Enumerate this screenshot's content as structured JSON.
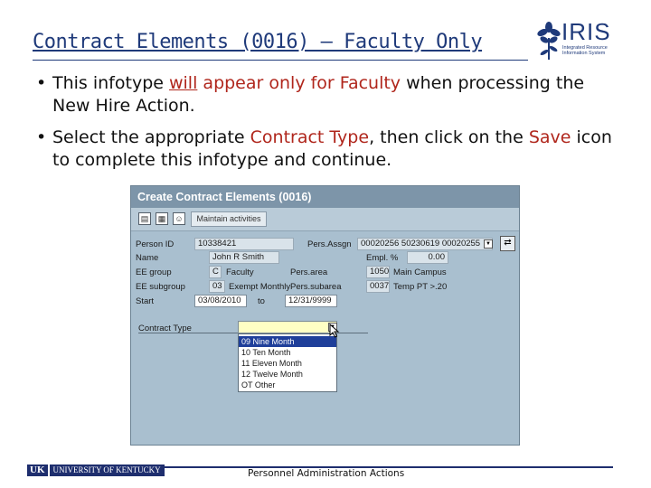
{
  "slide": {
    "title": "Contract Elements (0016) – Faculty Only",
    "bullets": [
      {
        "bullet_char": "•",
        "t1": "This infotype ",
        "t2": "will",
        "t3": " ",
        "t4": "appear only for Faculty",
        "t5": " when processing the New Hire Action."
      },
      {
        "bullet_char": "•",
        "t1": "Select the appropriate ",
        "t2": "Contract Type",
        "t3": ", then click on the ",
        "t4": "Save",
        "t5": " icon to complete this infotype and continue."
      }
    ],
    "footer": "Personnel Administration Actions",
    "highlight_color": "#b0261c",
    "title_color": "#1f3a7a"
  },
  "logo": {
    "word": "IRIS",
    "sub_lines": [
      "Integrated Resource",
      "Information System"
    ],
    "icon": "flower-icon"
  },
  "footer_logo": {
    "uk": "UK",
    "name": "UNIVERSITY OF KENTUCKY"
  },
  "sap": {
    "title": "Create Contract Elements (0016)",
    "toolbar": {
      "button_label": "Maintain activities",
      "icons": [
        "document-icon",
        "copy-icon",
        "person-icon"
      ]
    },
    "labels": {
      "person_id": "Person ID",
      "pers_assgn": "Pers.Assgn",
      "name": "Name",
      "empl_pct": "Empl. %",
      "ee_group": "EE group",
      "pers_area": "Pers.area",
      "ee_subgroup": "EE subgroup",
      "pers_subarea": "Pers.subarea",
      "start": "Start",
      "to": "to",
      "contract_type": "Contract Type"
    },
    "values": {
      "person_id": "10338421",
      "pers_assgn": "00020256 50230619 00020255",
      "name": "John   R   Smith",
      "empl_pct": "0.00",
      "ee_group_code": "C",
      "ee_group": "Faculty",
      "pers_area_code": "1050",
      "pers_area": "Main Campus",
      "ee_subgroup_code": "03",
      "ee_subgroup": "Exempt Monthly",
      "pers_subarea_code": "0037",
      "pers_subarea": "Temp PT >.20",
      "start": "03/08/2010",
      "end": "12/31/9999"
    },
    "dropdown_options": [
      {
        "code": "09",
        "label": "Nine Month",
        "selected": true
      },
      {
        "code": "10",
        "label": "Ten Month",
        "selected": false
      },
      {
        "code": "11",
        "label": "Eleven Month",
        "selected": false
      },
      {
        "code": "12",
        "label": "Twelve Month",
        "selected": false
      },
      {
        "code": "OT",
        "label": "Other",
        "selected": false
      }
    ],
    "colors": {
      "window_bg": "#a9bfcf",
      "title_bar": "#7d95a9",
      "selection": "#1f3f9a"
    }
  }
}
